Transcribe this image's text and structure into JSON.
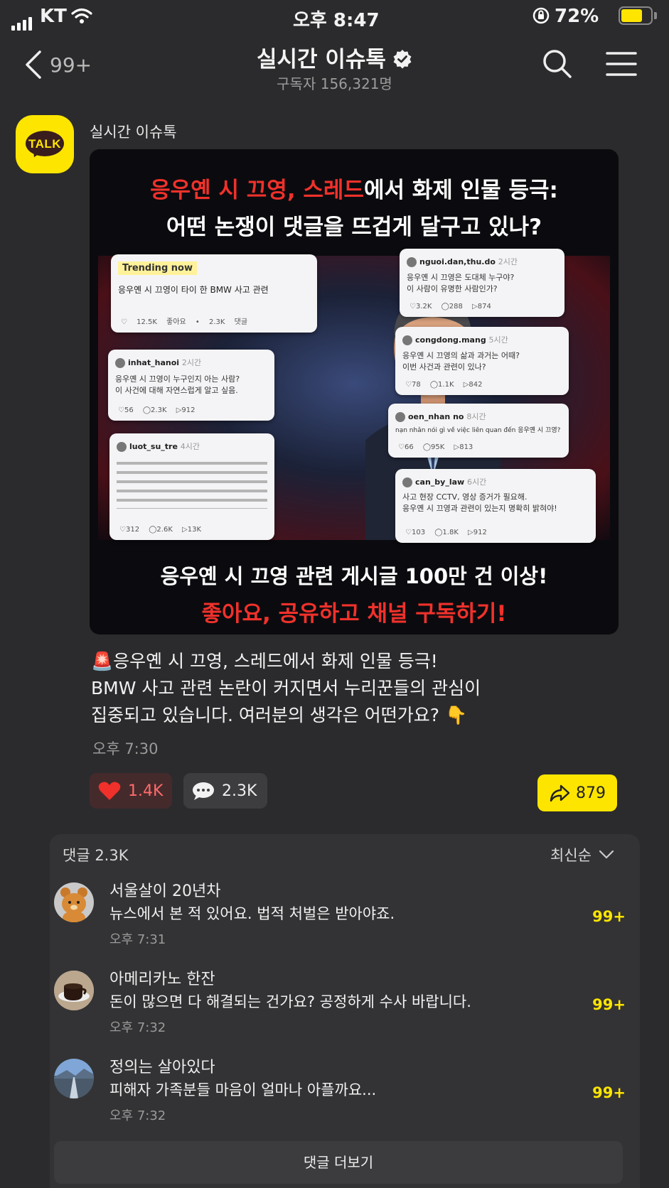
{
  "status_bar": {
    "carrier": "KT",
    "time": "오후 8:47",
    "battery": "72%"
  },
  "header": {
    "back_count": "99+",
    "title": "실시간 이슈톡",
    "subscribers": "구독자 156,321명"
  },
  "post": {
    "author": "실시간 이슈톡",
    "avatar_text": "TALK",
    "card": {
      "headline_red1": "응우옌 시 끄영, 스레드",
      "headline_white1": "에서 화제 인물 등극:",
      "headline2": "어떤 논쟁이 댓글을 뜨겁게 달구고 있나?",
      "bottom1": "응우옌 시 끄영 관련 게시글 100만 건 이상!",
      "bottom2": "좋아요, 공유하고 채널 구독하기!",
      "trending": {
        "tag": "Trending now",
        "text": "응우옌 시 끄영이 타이 한 BMW 사고 관련",
        "stats": "♡ 12.5K 좋아요 • 2.3K 댓글"
      },
      "posts": [
        {
          "user": "inhat_hanoi",
          "time": "2시간",
          "text1": "응우옌 시 끄영이 누구인지 아는 사람?",
          "text2": "이 사건에 대해 자연스럽게 알고 싶음.",
          "stats": "♡56 ◯2.3K ▷912"
        },
        {
          "user": "luot_su_tre",
          "time": "4시간",
          "text1": "",
          "text2": "",
          "stats": "♡312 ◯2.6K ▷13K"
        },
        {
          "user": "nguoi.dan,thu.do",
          "time": "2시간",
          "text1": "응우옌 시 끄영은 도대체 누구야?",
          "text2": "이 사람이 유명한 사람인가?",
          "stats": "♡3.2K ◯288 ▷874"
        },
        {
          "user": "congdong.mang",
          "time": "5시간",
          "text1": "응우옌 시 끄영의 삶과 과거는 어때?",
          "text2": "이번 사건과 관련이 있나?",
          "stats": "♡78 ◯1.1K ▷842"
        },
        {
          "user": "oen_nhan no",
          "time": "8시간",
          "text1": "nạn nhân nói gì về việc liên quan đến 응우옌 시 끄영?",
          "text2": "",
          "stats": "♡66 ◯95K ▷813"
        },
        {
          "user": "can_by_law",
          "time": "6시간",
          "text1": "사고 현장 CCTV, 영상 증거가 필요해.",
          "text2": "응우옌 시 끄영과 관련이 있는지 명확히 밝혀야!",
          "stats": "♡103 ◯1.8K ▷912"
        }
      ]
    },
    "caption": {
      "emoji": "🚨",
      "line1": "응우옌 시 끄영, 스레드에서 화제 인물 등극!",
      "line2": "BMW 사고 관련 논란이 커지면서 누리꾼들의 관심이",
      "line3": "집중되고 있습니다. 여러분의 생각은 어떤가요? 👇"
    },
    "time": "오후 7:30",
    "likes": "1.4K",
    "comments_count": "2.3K",
    "shares": "879"
  },
  "comments": {
    "header": "댓글 2.3K",
    "sort": "최신순",
    "items": [
      {
        "name": "서울살이 20년차",
        "text": "뉴스에서 본 적 있어요. 법적 처벌은 받아야죠.",
        "time": "오후 7:31",
        "count": "99+"
      },
      {
        "name": "아메리카노 한잔",
        "text": "돈이 많으면 다 해결되는 건가요? 공정하게 수사 바랍니다.",
        "time": "오후 7:32",
        "count": "99+"
      },
      {
        "name": "정의는 살아있다",
        "text": "피해자 가족분들 마음이 얼마나 아플까요...",
        "time": "오후 7:32",
        "count": "99+"
      }
    ],
    "more": "댓글 더보기"
  },
  "colors": {
    "accent": "#fee500",
    "background": "#2b2b2d",
    "red": "#f0312b"
  }
}
